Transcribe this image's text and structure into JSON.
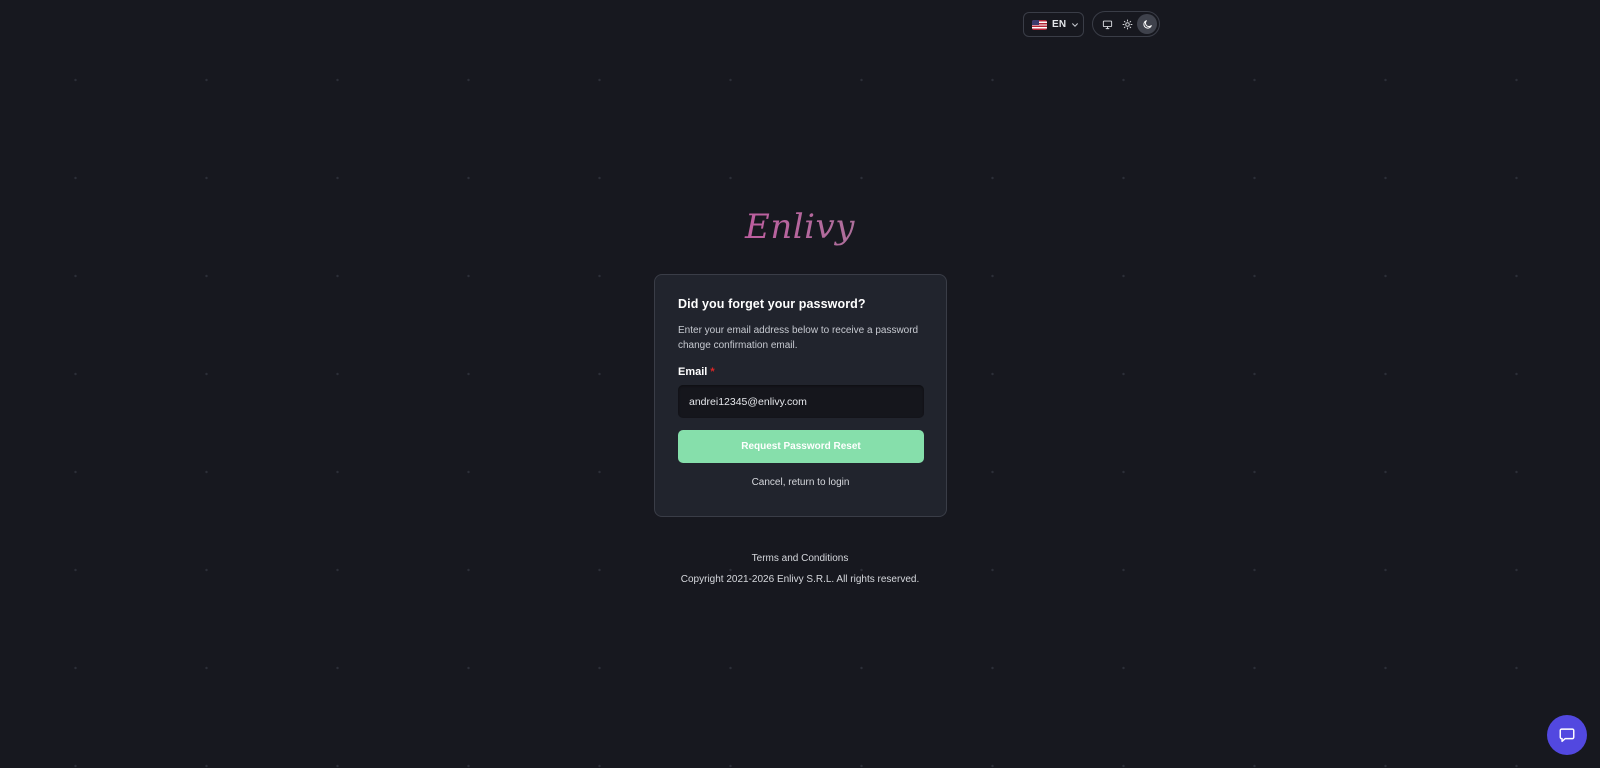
{
  "header": {
    "language": {
      "code": "EN",
      "flag": "us-flag-icon"
    },
    "theme": {
      "options": [
        "system",
        "light",
        "dark"
      ],
      "selected": "dark"
    }
  },
  "logo": {
    "text": "Enlivy",
    "colors": [
      "#c24a8a",
      "#5e9f86"
    ]
  },
  "form": {
    "title": "Did you forget your password?",
    "description": "Enter your email address below to receive a password change confirmation email.",
    "email_label": "Email",
    "required_mark": "*",
    "email_value": "andrei12345@enlivy.com",
    "submit_label": "Request Password Reset",
    "cancel_label": "Cancel, return to login"
  },
  "footer": {
    "terms": "Terms and Conditions",
    "copyright": "Copyright 2021-2026 Enlivy S.R.L. All rights reserved."
  },
  "colors": {
    "background": "#17181f",
    "card": "#21242d",
    "accent": "#86dfab",
    "chat": "#5248e0"
  }
}
